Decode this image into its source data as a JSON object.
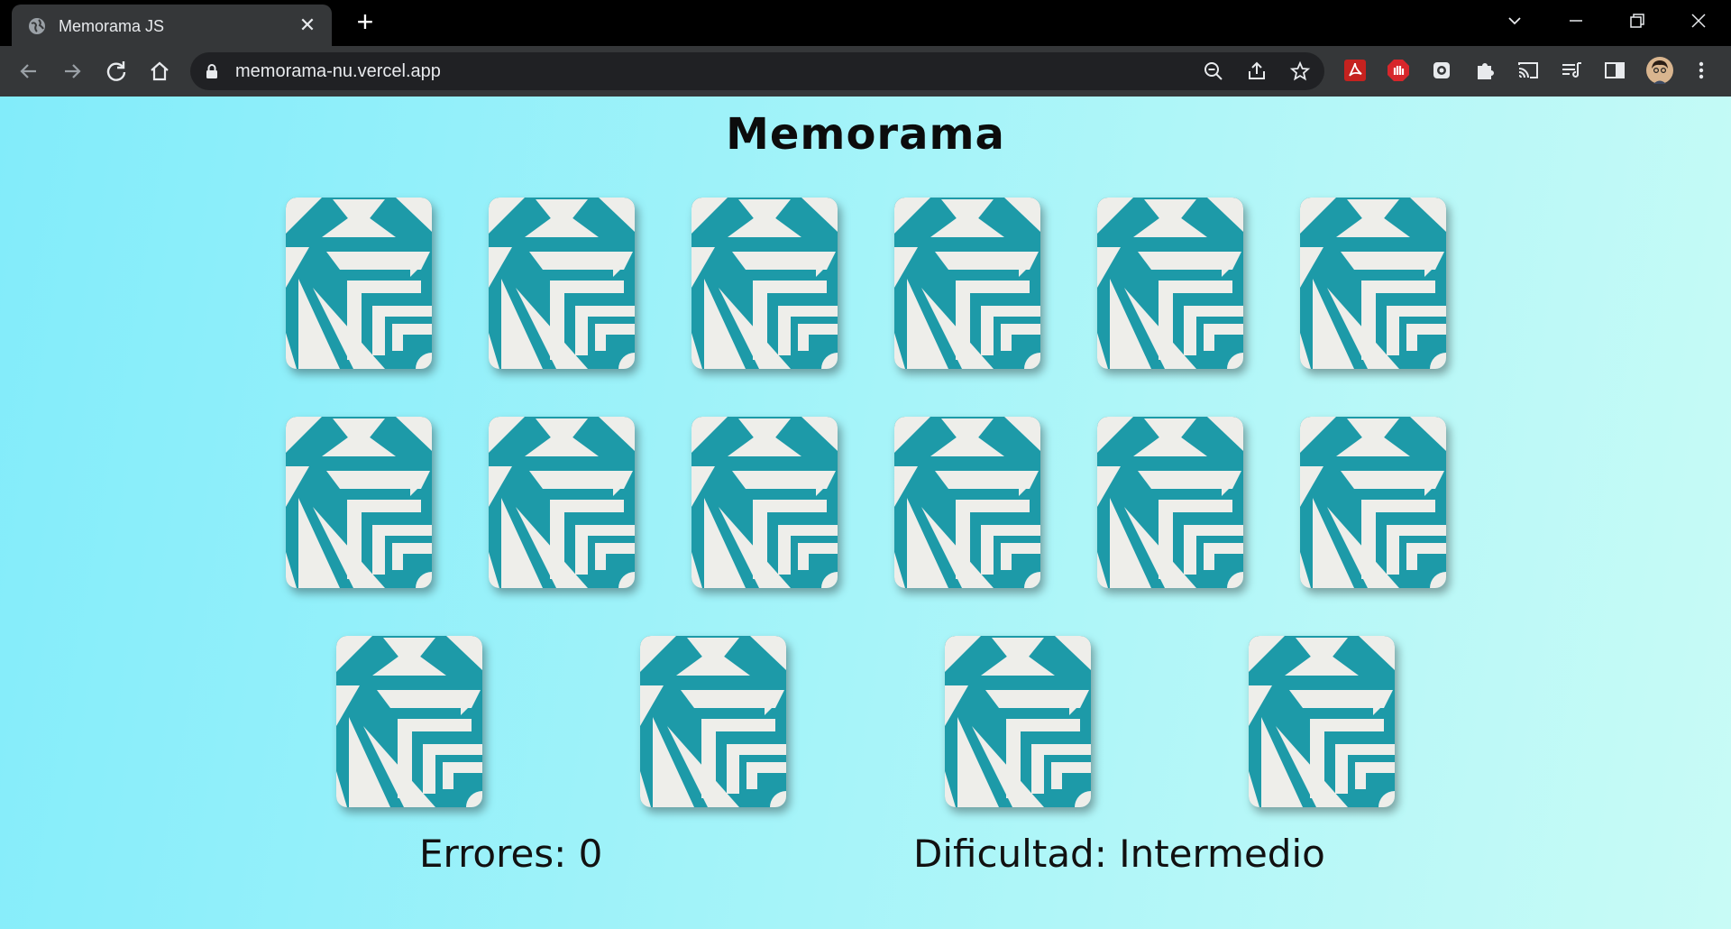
{
  "browser": {
    "tab_title": "Memorama JS",
    "url": "memorama-nu.vercel.app"
  },
  "page": {
    "title": "Memorama",
    "errors_label": "Errores: 0",
    "difficulty_label": "Dificultad: Intermedio"
  },
  "cards": {
    "count": 16,
    "state": "face-down",
    "back_color": "#1d9aa8"
  }
}
